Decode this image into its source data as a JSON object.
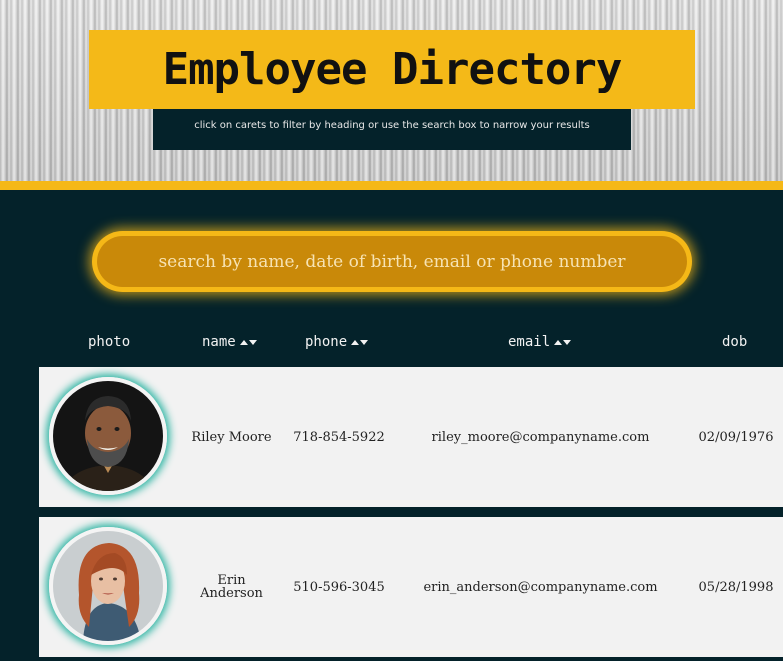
{
  "header": {
    "title": "Employee Directory",
    "subtitle": "click on carets to filter by heading or use the search box to narrow your results"
  },
  "search": {
    "placeholder": "search by name, date of birth, email or phone number"
  },
  "table": {
    "columns": [
      {
        "label": "photo",
        "sortable": false
      },
      {
        "label": "name",
        "sortable": true
      },
      {
        "label": "phone",
        "sortable": true
      },
      {
        "label": "email",
        "sortable": true
      },
      {
        "label": "dob",
        "sortable": false
      }
    ],
    "rows": [
      {
        "name": "Riley Moore",
        "phone": "718-854-5922",
        "email": "riley_moore@companyname.com",
        "dob": "02/09/1976",
        "photo": "avatar-man-beard"
      },
      {
        "name": "Erin Anderson",
        "phone": "510-596-3045",
        "email": "erin_anderson@companyname.com",
        "dob": "05/28/1998",
        "photo": "avatar-woman-red-hair"
      }
    ]
  },
  "colors": {
    "accent": "#f5b817",
    "background": "#04222a",
    "row": "#f2f2f2",
    "avatar_glow": "#2fb5a4"
  }
}
